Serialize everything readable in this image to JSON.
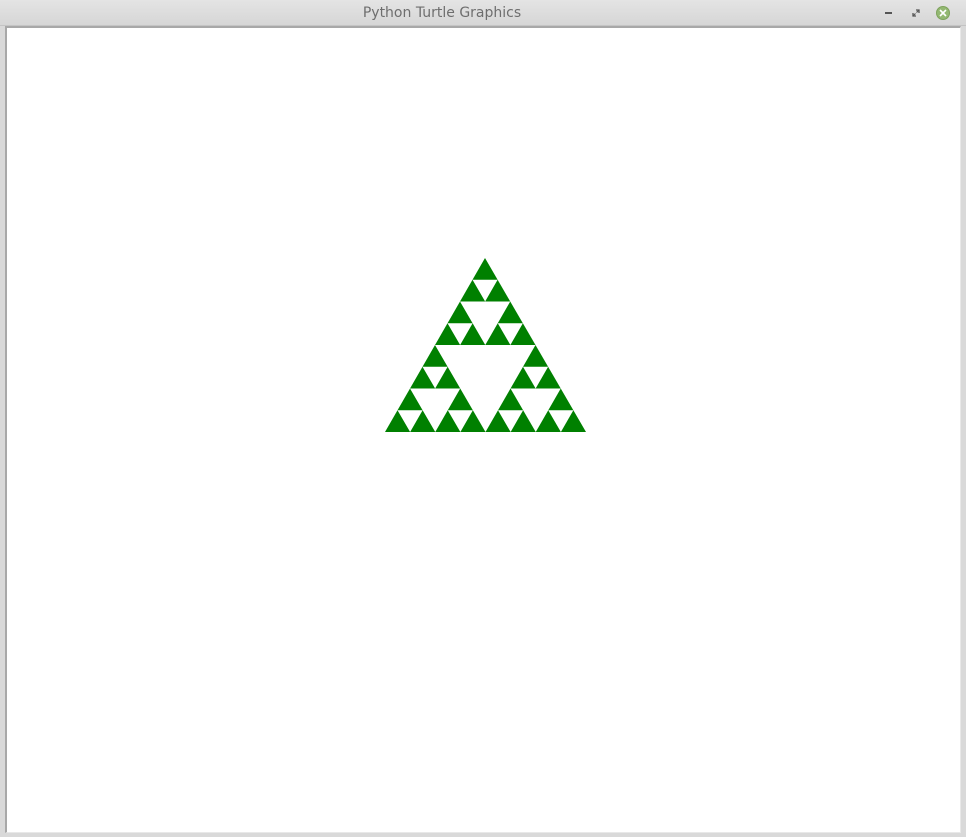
{
  "window": {
    "title": "Python Turtle Graphics"
  },
  "controls": {
    "minimize_icon": "minimize-icon",
    "maximize_icon": "restore-icon",
    "close_icon": "close-icon"
  },
  "canvas": {
    "background": "#ffffff",
    "figure": "sierpinski-triangle",
    "recursion_depth": 3,
    "fill_color": "#008000",
    "hole_color": "#ffffff"
  }
}
